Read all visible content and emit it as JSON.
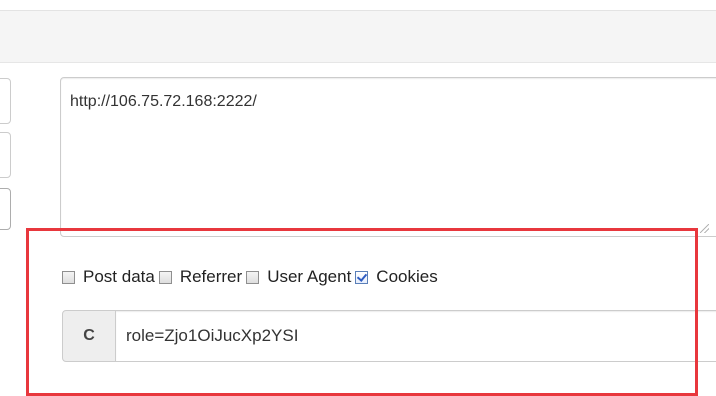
{
  "url_field": {
    "value": "http://106.75.72.168:2222/"
  },
  "options": [
    {
      "label": "Post data",
      "checked": false
    },
    {
      "label": "Referrer",
      "checked": false
    },
    {
      "label": "User Agent",
      "checked": false
    },
    {
      "label": "Cookies",
      "checked": true
    }
  ],
  "cookie_field": {
    "addon_label": "C",
    "value": "role=Zjo1OiJucXp2YSI"
  },
  "colors": {
    "highlight_border": "#e8373d",
    "checkbox_check": "#2e5cc2"
  }
}
